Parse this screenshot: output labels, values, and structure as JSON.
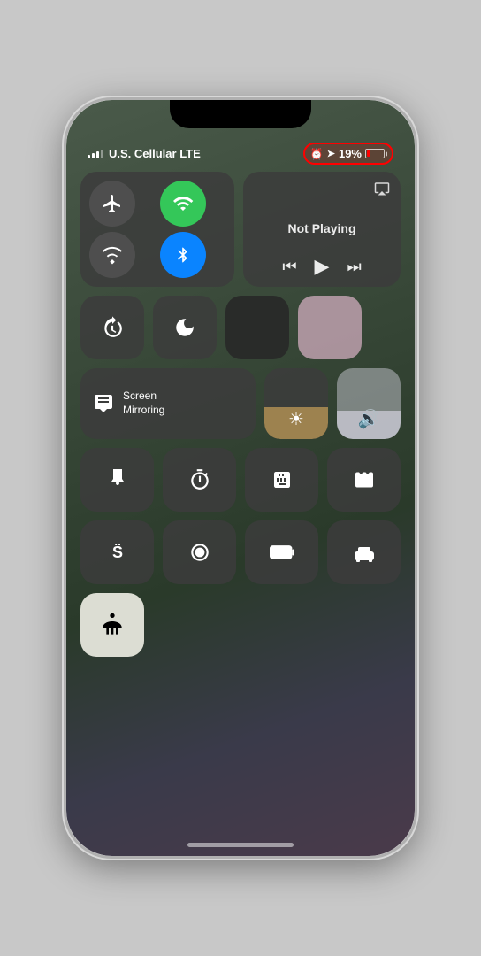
{
  "status_bar": {
    "carrier": "U.S. Cellular LTE",
    "alarm_icon": "⏰",
    "location_icon": "➤",
    "battery_percent": "19%",
    "signal_bars": [
      4,
      6,
      8,
      10,
      12
    ]
  },
  "now_playing": {
    "title": "Not Playing",
    "airplay_label": "AirPlay"
  },
  "connectivity": {
    "airplane_label": "Airplane Mode",
    "wifi_label": "Wi-Fi",
    "cellular_label": "Cellular",
    "bluetooth_label": "Bluetooth"
  },
  "controls": {
    "rotation_lock_label": "Rotation Lock",
    "do_not_disturb_label": "Do Not Disturb",
    "screen_mirroring_label": "Screen\nMirroring",
    "brightness_label": "Brightness",
    "volume_label": "Volume"
  },
  "app_buttons": {
    "flashlight": "Flashlight",
    "timer": "Timer",
    "calculator": "Calculator",
    "camera": "Camera",
    "shazam": "Shazam",
    "screen_record": "Screen Recording",
    "battery": "Low Power Mode",
    "bed": "Sleep"
  },
  "accessibility": {
    "label": "Accessibility Shortcut"
  }
}
